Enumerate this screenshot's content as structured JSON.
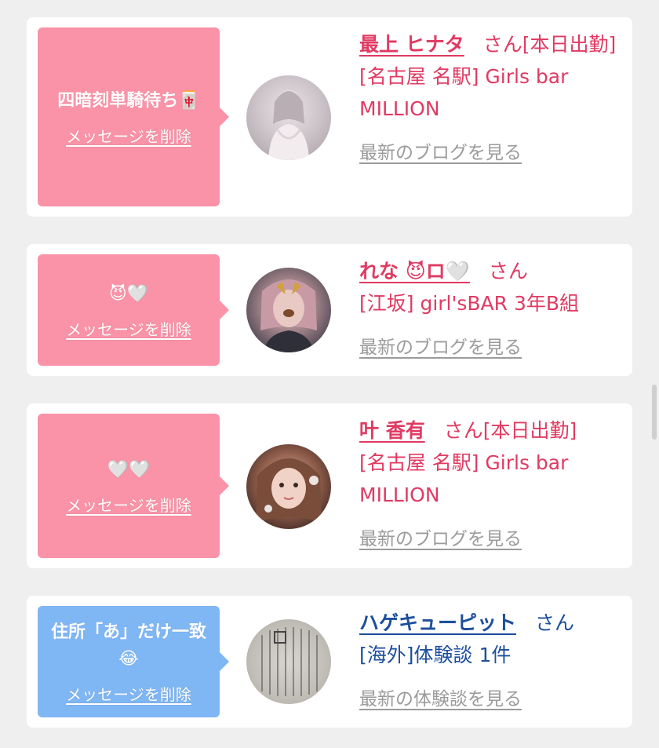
{
  "colors": {
    "background": "#efefef",
    "card": "#ffffff",
    "bubble_pink": "#fa93a8",
    "bubble_blue": "#7fb6f4",
    "name_pink": "#e03a62",
    "name_blue": "#1d4f9c",
    "link_gray": "#9b9b9b"
  },
  "items": [
    {
      "message": "四暗刻単騎待ち🀄",
      "delete_label": "メッセージを削除",
      "name": "最上 ヒナタ",
      "honorific": "さん",
      "status": "[本日出勤]",
      "shop": "[名古屋 名駅] Girls bar MILLION",
      "link": "最新のブログを見る",
      "avatar_icon": "profile-photo"
    },
    {
      "message": "😈🤍",
      "delete_label": "メッセージを削除",
      "name": "れな 😈ロ🤍",
      "honorific": "さん",
      "status": "",
      "shop": "[江坂] girl'sBAR 3年B組",
      "link": "最新のブログを見る",
      "avatar_icon": "profile-photo"
    },
    {
      "message": "🤍🤍",
      "delete_label": "メッセージを削除",
      "name": "叶 香有",
      "honorific": "さん",
      "status": "[本日出勤]",
      "shop": "[名古屋 名駅] Girls bar MILLION",
      "link": "最新のブログを見る",
      "avatar_icon": "profile-photo"
    },
    {
      "message": "住所「あ」だけ一致😂",
      "delete_label": "メッセージを削除",
      "name": "ハゲキューピット",
      "honorific": "さん",
      "status": "",
      "shop": "[海外]体験談 1件",
      "link": "最新の体験談を見る",
      "avatar_icon": "document-photo"
    }
  ]
}
